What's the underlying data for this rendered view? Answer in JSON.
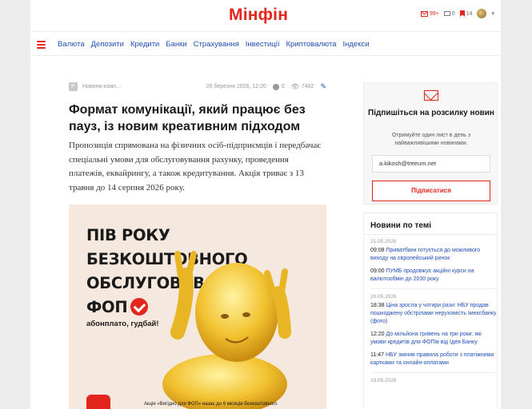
{
  "header": {
    "logo": "Мінфін",
    "mail_count": "99+",
    "comments_count": "0",
    "bookmarks_count": "14"
  },
  "nav": {
    "items": [
      "Валюта",
      "Депозити",
      "Кредити",
      "Банки",
      "Страхування",
      "Інвестиції",
      "Криптовалюта",
      "Індекси"
    ]
  },
  "article": {
    "category": "Новини комп...",
    "date": "26 березня 2026, 12:20",
    "comments": "0",
    "views": "7482",
    "title": "Формат комунікації, який працює без пауз, із новим креативним підходом",
    "lead": "Пропозиція спрямована на фізичних осіб-підприємців і передбачає спеціальні умови для обслуговування рахунку, проведення платежів, еквайрингу, а також кредитування. Акція триває з 13 травня до 14 серпня 2026 року."
  },
  "promo": {
    "line1": "ПІВ РОКУ",
    "line2": "БЕЗКОШТОВНОГО",
    "line3": "ОБСЛУГОВУВАННЯ",
    "line4": "ФОП",
    "slogan": "абонплато, гудбай!",
    "footnote": "Акція «Вигідно для ФОП» назає до 6 місяців безкоштовного"
  },
  "subscribe": {
    "title": "Підпишіться на розсилку новин",
    "text": "Отримуйте один лист в день з найважливішими новинами.",
    "email": "a.kikosh@treeum.net",
    "button": "Підписатися"
  },
  "related": {
    "title": "Новини по темі",
    "groups": [
      {
        "date": "21.05.2026",
        "items": [
          {
            "time": "09:08",
            "text": "Приватбанк готується до можливого виходу на європейський ринок"
          },
          {
            "time": "09:00",
            "text": "ПУМБ продовжує акційні курси на валютообмін до 2030 року"
          }
        ]
      },
      {
        "date": "20.05.2026",
        "items": [
          {
            "time": "18:38",
            "text": "Ціна зросла у чотири рази: НБУ продав пошкоджену обстрілами нерухомість Імексбанку (фото)"
          },
          {
            "time": "12:20",
            "text": "До мільйона гривень на три роки: які умови кредитів для ФОПів від Ідея Банку"
          },
          {
            "time": "11:47",
            "text": "НБУ змінив правила роботи з платіжними картками та онлайн-оплатами"
          }
        ]
      },
      {
        "date": "19.05.2026",
        "items": []
      }
    ]
  },
  "colors": {
    "accent": "#e3261d",
    "link": "#1f4fb5"
  }
}
